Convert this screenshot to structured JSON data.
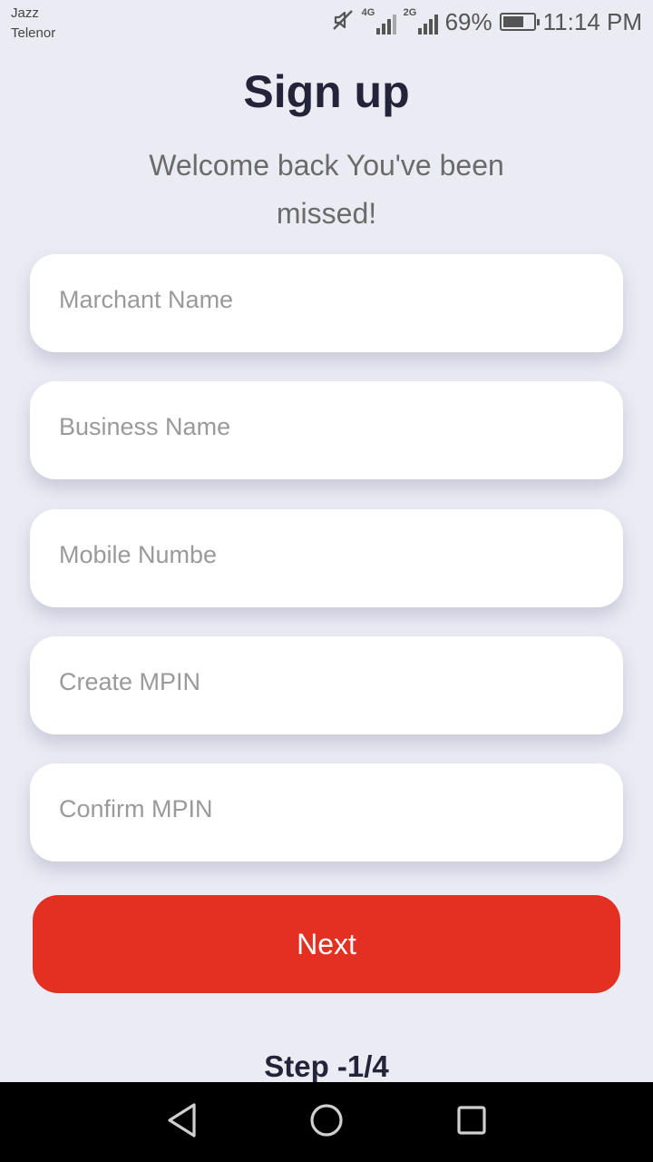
{
  "status_bar": {
    "carrier_1": "Jazz",
    "carrier_2": "Telenor",
    "sim1_network": "4G",
    "sim2_network": "2G",
    "battery_percent": "69%",
    "battery_level": 0.69,
    "time": "11:14 PM",
    "icons": [
      "mute-icon",
      "signal-icon",
      "battery-icon"
    ]
  },
  "header": {
    "title": "Sign up",
    "subtitle": "Welcome back You've been missed!"
  },
  "form": {
    "merchant_name": {
      "placeholder": "Marchant Name",
      "value": ""
    },
    "business_name": {
      "placeholder": "Business Name",
      "value": ""
    },
    "mobile_number": {
      "placeholder": "Mobile Numbe",
      "value": ""
    },
    "create_mpin": {
      "placeholder": "Create MPIN",
      "value": ""
    },
    "confirm_mpin": {
      "placeholder": "Confirm MPIN",
      "value": ""
    }
  },
  "next_button": {
    "label": "Next"
  },
  "step": {
    "label": "Step -1/4"
  },
  "nav_bar": {
    "icons": [
      "back-icon",
      "home-icon",
      "recents-icon"
    ]
  },
  "colors": {
    "background": "#ebebf4",
    "primary": "#e33022",
    "title": "#23233a",
    "placeholder": "#9a9a9a"
  }
}
